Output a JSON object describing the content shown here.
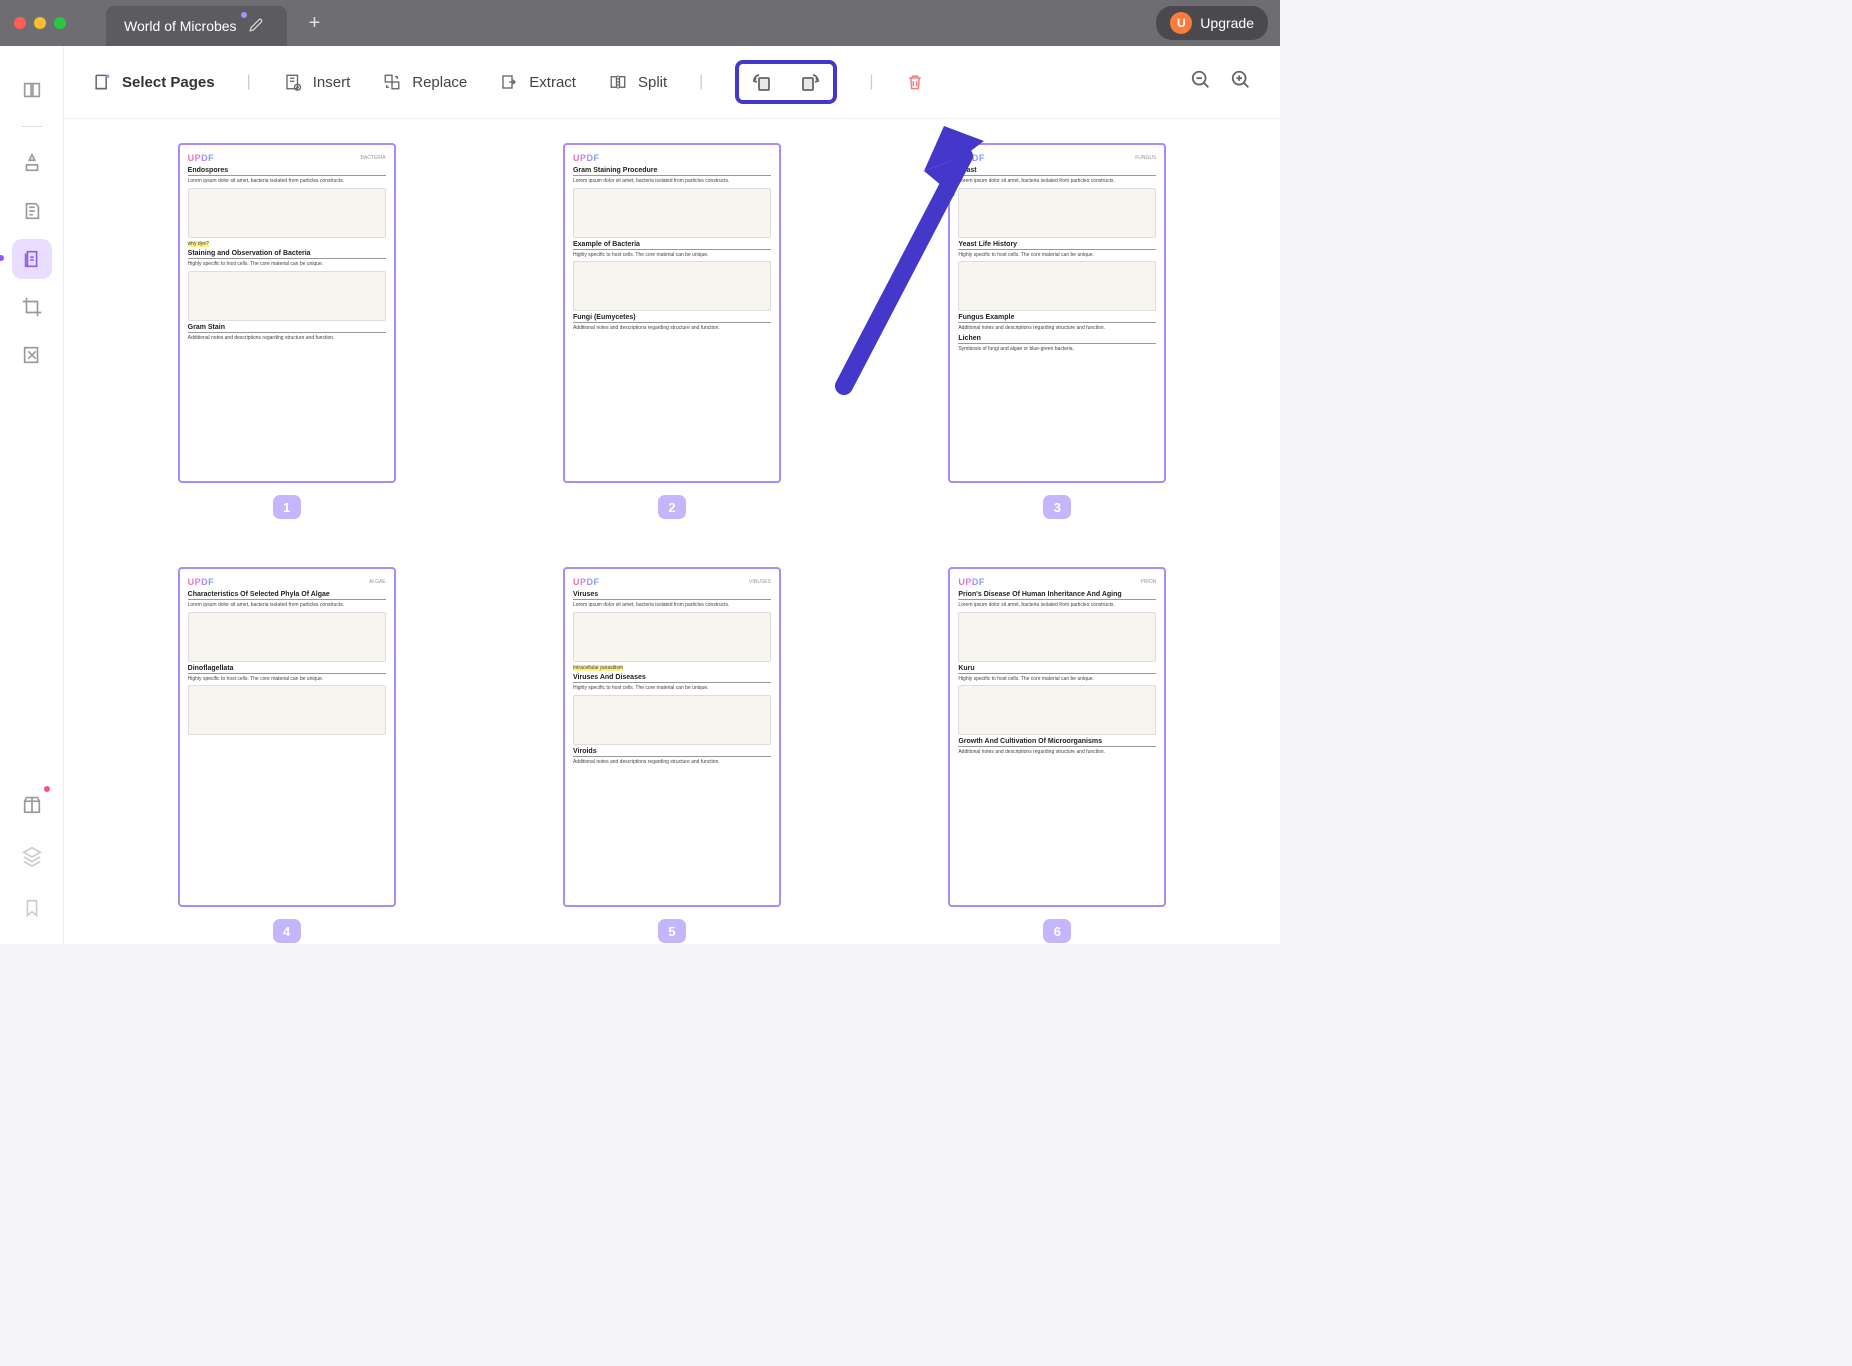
{
  "titlebar": {
    "tab_title": "World of Microbes",
    "upgrade_label": "Upgrade",
    "upgrade_initial": "U"
  },
  "toolbar": {
    "select_pages": "Select Pages",
    "insert": "Insert",
    "replace": "Replace",
    "extract": "Extract",
    "split": "Split"
  },
  "pages": [
    {
      "num": "1",
      "tag": "BACTERIA",
      "title1": "Endospores",
      "title2": "Staining and Observation of Bacteria",
      "title3": "Gram Stain",
      "hl": "why dye?"
    },
    {
      "num": "2",
      "tag": "",
      "title1": "Gram Staining Procedure",
      "title2": "Example of Bacteria",
      "title3": "Fungi (Eumycetes)",
      "hl": ""
    },
    {
      "num": "3",
      "tag": "FUNGUS",
      "title1": "Yeast",
      "title2": "Yeast Life History",
      "title3": "Fungus Example",
      "title4": "Lichen",
      "hl": ""
    },
    {
      "num": "4",
      "tag": "ALGAE",
      "title1": "Characteristics Of Selected Phyla Of Algae",
      "title2": "Dinoflagellata",
      "title3": "",
      "hl": ""
    },
    {
      "num": "5",
      "tag": "VIRUSES",
      "title1": "Viruses",
      "title2": "Viruses And Diseases",
      "title3": "Viroids",
      "hl": "Intracellular parasitism"
    },
    {
      "num": "6",
      "tag": "PRION",
      "title1": "Prion's Disease Of Human Inheritance And Aging",
      "title2": "Kuru",
      "title3": "Growth And Cultivation Of Microorganisms",
      "hl": ""
    }
  ]
}
